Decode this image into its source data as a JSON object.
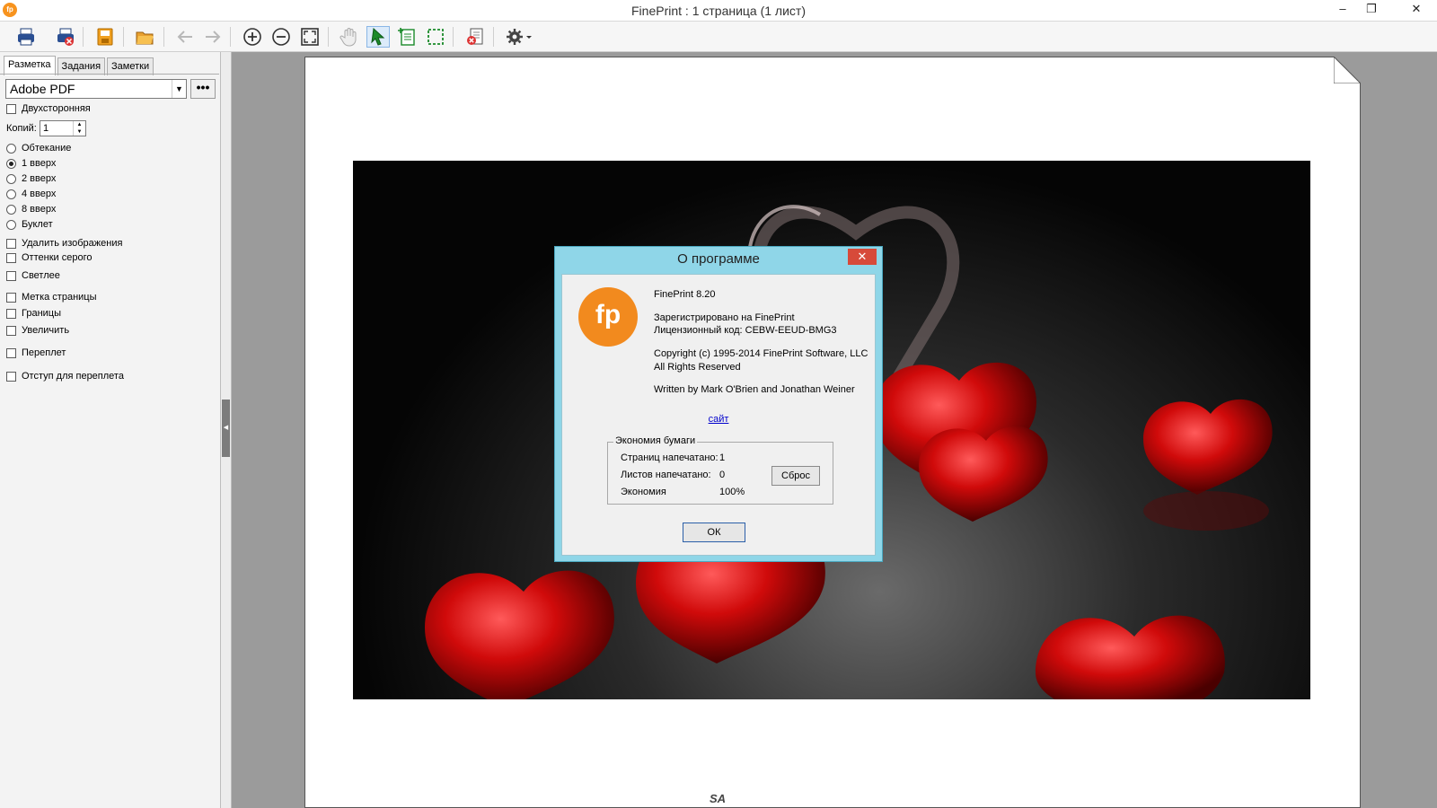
{
  "window": {
    "title": "FinePrint : 1 страница (1 лист)",
    "logo_text": "fp"
  },
  "toolbar": {
    "icons": [
      "print-icon",
      "print-delete-icon",
      "save-icon",
      "open-folder-icon",
      "back-arrow-icon",
      "forward-arrow-icon",
      "zoom-in-icon",
      "zoom-out-icon",
      "fit-page-icon",
      "hand-icon",
      "select-pointer-icon",
      "add-page-icon",
      "select-area-icon",
      "delete-job-icon",
      "settings-gear-icon"
    ]
  },
  "left_panel": {
    "tabs": [
      "Разметка",
      "Задания",
      "Заметки"
    ],
    "printer": "Adobe PDF",
    "more_label": "•••",
    "duplex": "Двухсторонняя",
    "copies_label": "Копий:",
    "copies_value": "1",
    "layouts": [
      "Обтекание",
      "1 вверх",
      "2 вверх",
      "4 вверх",
      "8 вверх",
      "Буклет"
    ],
    "selected_layout": "1 вверх",
    "options_a": [
      "Удалить изображения",
      "Оттенки серого",
      "Светлее"
    ],
    "options_b": [
      "Метка страницы",
      "Границы",
      "Увеличить"
    ],
    "option_binding": "Переплет",
    "option_gutter": "Отступ для переплета"
  },
  "page": {
    "footer_mark": "SA"
  },
  "dialog": {
    "title": "О программе",
    "close_label": "✕",
    "logo_text": "fp",
    "version": "FinePrint 8.20",
    "registered": "Зарегистрировано на FinePrint",
    "license": "Лицензионный код: CEBW-EEUD-BMG3",
    "copyright": "Copyright (c) 1995-2014 FinePrint Software, LLC",
    "rights": "All Rights Reserved",
    "written_by": "Written by Mark O'Brien and Jonathan Weiner",
    "site_link": "сайт",
    "savings": {
      "legend": "Экономия бумаги",
      "pages_label": "Страниц напечатано:",
      "pages_value": "1",
      "sheets_label": "Листов напечатано:",
      "sheets_value": "0",
      "economy_label": "Экономия",
      "economy_value": "100%",
      "reset_label": "Сброс"
    },
    "ok_label": "ОК"
  }
}
